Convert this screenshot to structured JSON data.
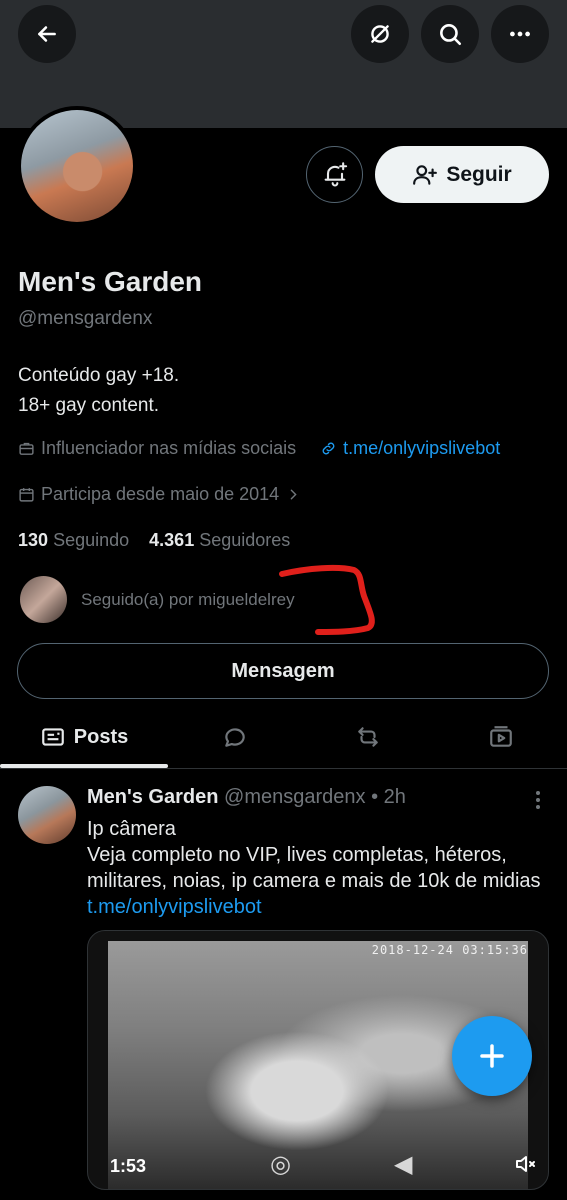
{
  "profile": {
    "name": "Men's Garden",
    "handle": "@mensgardenx",
    "bio_line1": "Conteúdo gay +18.",
    "bio_line2": "18+ gay content.",
    "category": "Influenciador nas mídias sociais",
    "website": "t.me/onlyvipslivebot",
    "joined": "Participa desde maio de 2014",
    "following_count": "130",
    "following_label": "Seguindo",
    "followers_count": "4.361",
    "followers_label": "Seguidores",
    "followed_by": "Seguido(a) por migueldelrey"
  },
  "actions": {
    "follow_label": "Seguir",
    "message_label": "Mensagem"
  },
  "tabs": [
    {
      "label": "Posts",
      "icon": "posts-icon"
    },
    {
      "label": "",
      "icon": "replies-icon"
    },
    {
      "label": "",
      "icon": "reposts-icon"
    },
    {
      "label": "",
      "icon": "media-icon"
    }
  ],
  "post": {
    "author": "Men's Garden",
    "meta": "@mensgardenx • 2h",
    "line1": "Ip câmera",
    "line2": "Veja completo no VIP, lives completas, héteros, militares, noias, ip camera e mais de 10k de midias",
    "link": "t.me/onlyvipslivebot",
    "video_timestamp": "2018-12-24 03:15:36",
    "video_time": "1:53"
  },
  "colors": {
    "accent": "#1d9bf0",
    "background": "#000000",
    "muted_text": "#71767b",
    "annotation": "#e0201b"
  }
}
